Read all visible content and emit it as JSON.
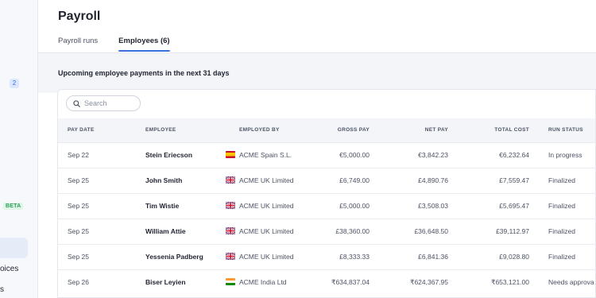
{
  "sidebar": {
    "badge": "2",
    "beta": "BETA",
    "text1": "oices",
    "text2": "s"
  },
  "page": {
    "title": "Payroll",
    "tabs": [
      {
        "label": "Payroll runs",
        "active": false
      },
      {
        "label": "Employees (6)",
        "active": true
      }
    ],
    "subtitle": "Upcoming employee payments in the next 31 days"
  },
  "search": {
    "placeholder": "Search",
    "value": ""
  },
  "table": {
    "headers": {
      "pay_date": "PAY DATE",
      "employee": "EMPLOYEE",
      "employed_by": "EMPLOYED BY",
      "gross_pay": "GROSS PAY",
      "net_pay": "NET PAY",
      "total_cost": "TOTAL COST",
      "run_status": "RUN STATUS"
    },
    "rows": [
      {
        "pay_date": "Sep 22",
        "employee": "Stein Eriecson",
        "flag": "es-flag-icon",
        "employed_by": "ACME Spain S.L.",
        "gross_pay": "€5,000.00",
        "net_pay": "€3,842.23",
        "total_cost": "€6,232.64",
        "run_status": "In progress"
      },
      {
        "pay_date": "Sep 25",
        "employee": "John Smith",
        "flag": "uk-flag-icon",
        "employed_by": "ACME UK Limited",
        "gross_pay": "£6,749.00",
        "net_pay": "£4,890.76",
        "total_cost": "£7,559.47",
        "run_status": "Finalized"
      },
      {
        "pay_date": "Sep 25",
        "employee": "Tim Wistie",
        "flag": "uk-flag-icon",
        "employed_by": "ACME UK Limited",
        "gross_pay": "£5,000.00",
        "net_pay": "£3,508.03",
        "total_cost": "£5,695.47",
        "run_status": "Finalized"
      },
      {
        "pay_date": "Sep 25",
        "employee": "William Attie",
        "flag": "uk-flag-icon",
        "employed_by": "ACME UK Limited",
        "gross_pay": "£38,360.00",
        "net_pay": "£36,648.50",
        "total_cost": "£39,112.97",
        "run_status": "Finalized"
      },
      {
        "pay_date": "Sep 25",
        "employee": "Yessenia Padberg",
        "flag": "uk-flag-icon",
        "employed_by": "ACME UK Limited",
        "gross_pay": "£8,333.33",
        "net_pay": "£6,841.36",
        "total_cost": "£9,028.80",
        "run_status": "Finalized"
      },
      {
        "pay_date": "Sep 26",
        "employee": "Biser Leyien",
        "flag": "in-flag-icon",
        "employed_by": "ACME India Ltd",
        "gross_pay": "₹634,837.04",
        "net_pay": "₹624,367.95",
        "total_cost": "₹653,121.00",
        "run_status": "Needs approva"
      }
    ]
  }
}
